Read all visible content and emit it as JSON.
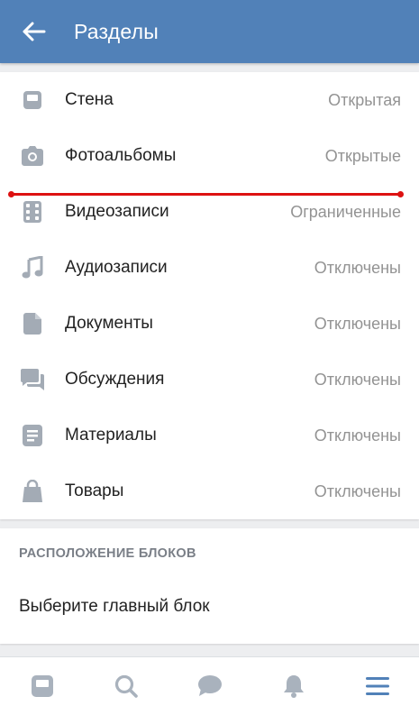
{
  "header": {
    "title": "Разделы"
  },
  "sections": [
    {
      "icon": "wall-icon",
      "label": "Стена",
      "value": "Открытая"
    },
    {
      "icon": "camera-icon",
      "label": "Фотоальбомы",
      "value": "Открытые"
    },
    {
      "icon": "film-icon",
      "label": "Видеозаписи",
      "value": "Ограниченные"
    },
    {
      "icon": "music-note-icon",
      "label": "Аудиозаписи",
      "value": "Отключены"
    },
    {
      "icon": "document-icon",
      "label": "Документы",
      "value": "Отключены"
    },
    {
      "icon": "discussion-icon",
      "label": "Обсуждения",
      "value": "Отключены"
    },
    {
      "icon": "article-icon",
      "label": "Материалы",
      "value": "Отключены"
    },
    {
      "icon": "shopping-bag-icon",
      "label": "Товары",
      "value": "Отключены"
    }
  ],
  "layout_section": {
    "heading": "РАСПОЛОЖЕНИЕ БЛОКОВ",
    "choose_label": "Выберите главный блок"
  },
  "tabbar": {
    "tabs": [
      "news-icon",
      "search-icon",
      "messages-icon",
      "notifications-icon",
      "menu-icon"
    ],
    "active_color": "#5181b8",
    "inactive_color": "#a9b2bd"
  },
  "colors": {
    "header_bg": "#5181b8",
    "icon_gray": "#a3abb5",
    "value_gray": "#939393",
    "annotation_red": "#dd1111"
  }
}
